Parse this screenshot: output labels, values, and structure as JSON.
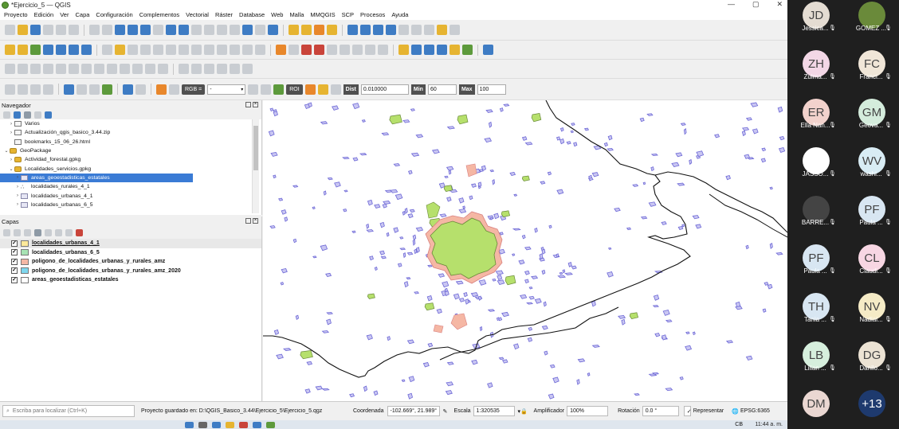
{
  "window": {
    "title": "*Ejercicio_5 — QGIS",
    "controls": [
      "—",
      "▢",
      "✕"
    ]
  },
  "menu": [
    "Proyecto",
    "Edición",
    "Ver",
    "Capa",
    "Configuración",
    "Complementos",
    "Vectorial",
    "Ráster",
    "Database",
    "Web",
    "Malla",
    "MMQGIS",
    "SCP",
    "Procesos",
    "Ayuda"
  ],
  "scp_toolbar": {
    "rgb_label": "RGB =",
    "rgb_value": "-",
    "roi_label": "ROI",
    "dist_label": "Dist",
    "dist_value": "0.010000",
    "min_label": "Min",
    "min_value": "60",
    "max_label": "Max",
    "max_value": "100"
  },
  "browser_panel": {
    "title": "Navegador",
    "items": [
      {
        "label": "Varios",
        "arrow": "›",
        "icon": "folder"
      },
      {
        "label": "Actualización_qgis_basico_3.44.zip",
        "arrow": "›",
        "icon": "folder"
      },
      {
        "label": "bookmarks_15_06_26.html",
        "arrow": "",
        "icon": "folder"
      },
      {
        "label": "GeoPackage",
        "arrow": "⌄",
        "icon": "gpkg"
      },
      {
        "label": "Actividad_forestal.gpkg",
        "arrow": "›",
        "icon": "gpkg"
      },
      {
        "label": "Localidades_servicios.gpkg",
        "arrow": "⌄",
        "icon": "gpkg"
      },
      {
        "label": "areas_geoestadisticas_estatales",
        "arrow": "›",
        "icon": "poly",
        "selected": true
      },
      {
        "label": "localidades_rurales_4_1",
        "arrow": "›",
        "icon": "pts"
      },
      {
        "label": "localidades_urbanas_4_1",
        "arrow": "›",
        "icon": "poly"
      },
      {
        "label": "localidades_urbanas_6_5",
        "arrow": "›",
        "icon": "poly"
      }
    ]
  },
  "layers_panel": {
    "title": "Capas",
    "layers": [
      {
        "name": "localidades_urbanas_4_1",
        "color": "#fde99a"
      },
      {
        "name": "localidades_urbanas_6_5",
        "color": "#a7e3b4"
      },
      {
        "name": "poligono_de_localidades_urbanas_y_rurales_amz",
        "color": "#f5b7a4"
      },
      {
        "name": "poligono_de_localidades_urbanas_y_rurales_amz_2020",
        "color": "#7fd7ee"
      },
      {
        "name": "areas_geoestadisticas_estatales",
        "color": "#ffffff"
      }
    ]
  },
  "statusbar": {
    "search_placeholder": "Escriba para localizar (Ctrl+K)",
    "saved_message": "Proyecto guardado en: D:\\QGIS_Basico_3.44\\Ejercicio_5\\Ejercicio_5.qgz",
    "coord_label": "Coordenada",
    "coord_value": "-102.669°, 21.989°",
    "scale_label": "Escala",
    "scale_value": "1:320535",
    "magnifier_label": "Amplificador",
    "magnifier_value": "100%",
    "rotation_label": "Rotación",
    "rotation_value": "0.0 °",
    "render_label": "Representar",
    "crs": "EPSG:6365"
  },
  "taskbar": {
    "clock": "11:44 a. m.",
    "lang": "CB"
  },
  "participants": [
    {
      "initials": "JD",
      "name": "Jessica...",
      "color": "#e4dcd2",
      "muted": true
    },
    {
      "initials": "",
      "name": "GOMEZ ...",
      "color": "#6a8a3a",
      "muted": true,
      "photo": true
    },
    {
      "initials": "ZH",
      "name": "Zulma...",
      "color": "#f3d7e6",
      "muted": true
    },
    {
      "initials": "FC",
      "name": "Franci...",
      "color": "#f0e6d8",
      "muted": true
    },
    {
      "initials": "ER",
      "name": "Ella Nan...",
      "color": "#f2d2cc",
      "muted": true
    },
    {
      "initials": "GM",
      "name": "Geova...",
      "color": "#d4ecdc",
      "muted": true
    },
    {
      "initials": "",
      "name": "JASSO...",
      "color": "#ffffff",
      "muted": true,
      "photo": true
    },
    {
      "initials": "WV",
      "name": "washi...",
      "color": "#d8ecf4",
      "muted": true
    },
    {
      "initials": "",
      "name": "BARRE...",
      "color": "#444444",
      "muted": true,
      "photo": true
    },
    {
      "initials": "PF",
      "name": "Paula ...",
      "color": "#d8e6f2",
      "muted": true
    },
    {
      "initials": "PF",
      "name": "Paula ...",
      "color": "#d8e6f2",
      "muted": true
    },
    {
      "initials": "CL",
      "name": "Claudi...",
      "color": "#f7d6e3",
      "muted": true
    },
    {
      "initials": "TH",
      "name": "Tania ...",
      "color": "#d8e6f2",
      "muted": true
    },
    {
      "initials": "NV",
      "name": "Nadial...",
      "color": "#f5ebc6",
      "muted": true
    },
    {
      "initials": "LB",
      "name": "Lilian ...",
      "color": "#d6efdd",
      "muted": true
    },
    {
      "initials": "DG",
      "name": "Danilo...",
      "color": "#ece3d4",
      "muted": true
    },
    {
      "initials": "DM",
      "name": "",
      "color": "#ead7d2",
      "muted": false
    },
    {
      "initials": "+13",
      "name": "",
      "color": "#1e3a6e",
      "muted": false
    }
  ]
}
